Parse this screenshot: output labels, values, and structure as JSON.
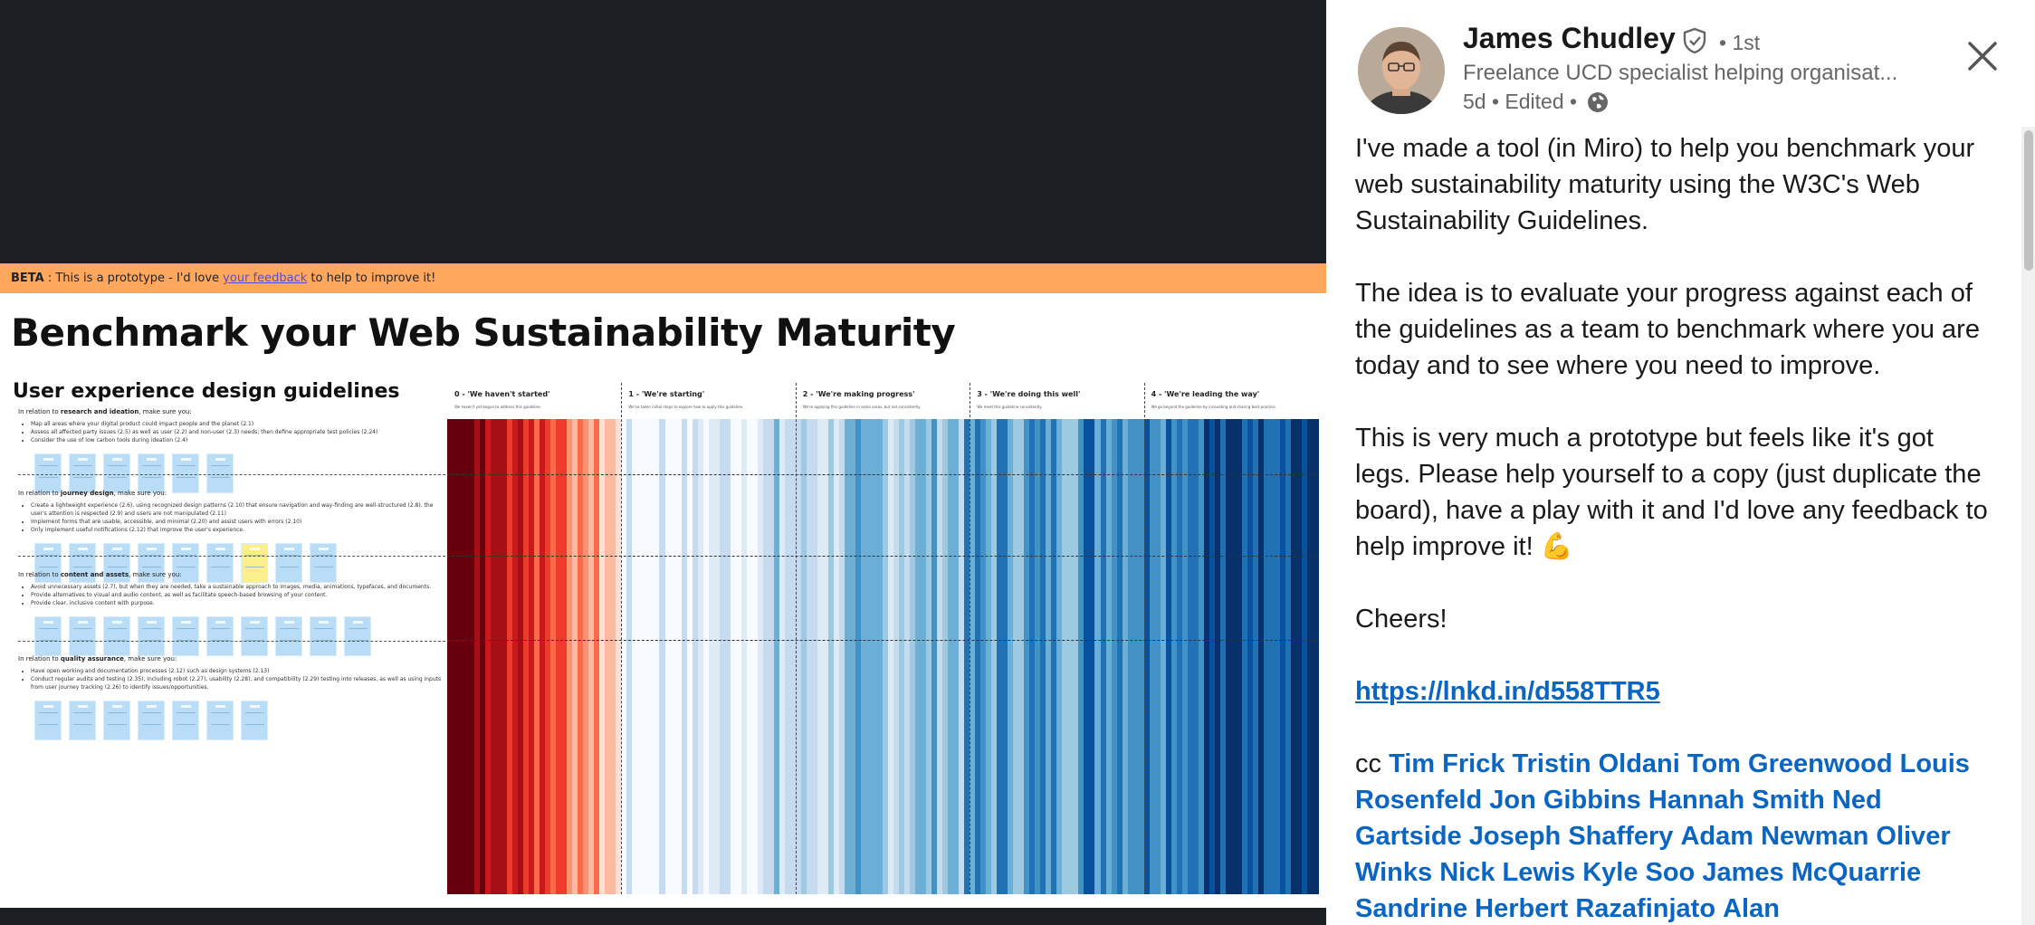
{
  "viewer": {
    "beta_label": "BETA",
    "beta_text_before": " : This is a prototype - I'd love ",
    "beta_link": "your feedback",
    "beta_text_after": " to help to improve it!",
    "slide_title": "Benchmark your Web Sustainability Maturity",
    "guidelines_title": "User experience design guidelines",
    "sections": [
      {
        "heading_pre": "In relation to ",
        "heading_bold": "research and ideation",
        "heading_post": ", make sure you:",
        "bullets": [
          "Map all areas where your digital product could impact people and the planet (2.1)",
          "Assess all affected party issues (2.5) as well as user (2.2) and non-user (2.3) needs; then define appropriate test policies (2.24)",
          "Consider the use of low carbon tools during ideation (2.4)"
        ],
        "cards": 6
      },
      {
        "heading_pre": "In relation to ",
        "heading_bold": "journey design",
        "heading_post": ", make sure you:",
        "bullets": [
          "Create a lightweight experience (2.6), using recognized design patterns (2.10) that ensure navigation and way-finding are well-structured (2.8), the user's attention is respected (2.9) and users are not manipulated (2.11)",
          "Implement forms that are usable, accessible, and minimal (2.20) and assist users with errors (2.10)",
          "Only implement useful notifications (2.12) that improve the user's experience."
        ],
        "cards": 9
      },
      {
        "heading_pre": "In relation to ",
        "heading_bold": "content and assets",
        "heading_post": ", make sure you:",
        "bullets": [
          "Avoid unnecessary assets (2.7), but when they are needed, take a sustainable approach to images, media, animations, typefaces, and documents.",
          "Provide alternatives to visual and audio content, as well as facilitate speech-based browsing of your content.",
          "Provide clear, inclusive content with purpose."
        ],
        "cards": 10
      },
      {
        "heading_pre": "In relation to ",
        "heading_bold": "quality assurance",
        "heading_post": ", make sure you:",
        "bullets": [
          "Have open working and documentation processes (2.12) such as design systems (2.13)",
          "Conduct regular audits and testing (2.35), including robot (2.27), usability (2.28), and compatibility (2.29) testing into releases, as well as using inputs from user journey tracking (2.26) to identify issues/opportunities."
        ],
        "cards": 7
      }
    ],
    "levels": [
      {
        "title": "0 - 'We haven't started'",
        "desc": "We haven't yet begun to address this guideline."
      },
      {
        "title": "1 - 'We're starting'",
        "desc": "We've taken initial steps to explore how to apply this guideline."
      },
      {
        "title": "2 - 'We're making progress'",
        "desc": "We're applying this guideline in some areas, but not consistently."
      },
      {
        "title": "3 - 'We're doing this well'",
        "desc": "We meet this guideline consistently."
      },
      {
        "title": "4 - 'We're leading the way'",
        "desc": "We go beyond the guideline by innovating and sharing best practice."
      }
    ],
    "colors": {
      "beta_bar": "#ffa75c",
      "dark_red": "#a50f15",
      "dark_blue": "#08306b"
    }
  },
  "post": {
    "author_name": "James Chudley",
    "degree": "• 1st",
    "headline": "Freelance UCD specialist helping organisat...",
    "meta": "5d • Edited •",
    "paragraphs": [
      "I've made a tool (in Miro) to help you benchmark your web sustainability maturity using the W3C's Web Sustainability Guidelines.",
      "The idea is to evaluate your progress against each of the guidelines as a team to benchmark where you are today and to see where you need to improve.",
      "This is very much a prototype but feels like it's got legs. Please help yourself to a copy (just duplicate the board), have a play with it and I'd love any feedback to help improve it! 💪",
      "Cheers!"
    ],
    "link": "https://lnkd.in/d558TTR5",
    "cc_label": "cc",
    "mentions": [
      "Tim Frick",
      "Tristin Oldani",
      "Tom Greenwood",
      "Louis Rosenfeld",
      "Jon Gibbins",
      "Hannah Smith",
      "Ned Gartside",
      "Joseph Shaffery",
      "Adam Newman",
      "Oliver Winks",
      "Nick Lewis",
      "Kyle Soo",
      "James McQuarrie",
      "Sandrine Herbert Razafinjato",
      "Alan"
    ],
    "colors": {
      "link": "#0a66c2",
      "text": "#1a1a1a",
      "muted": "#666666"
    }
  }
}
